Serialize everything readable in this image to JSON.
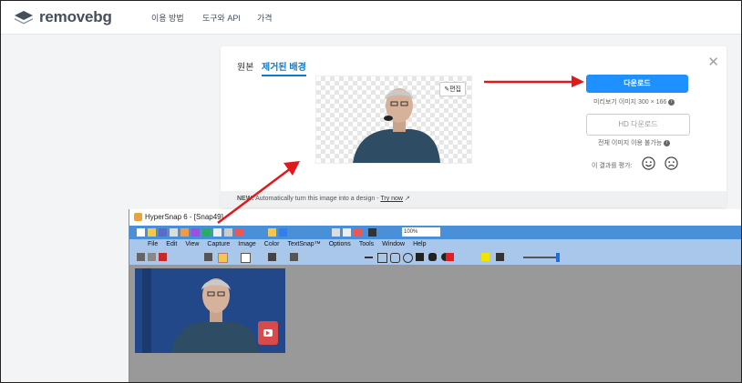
{
  "header": {
    "logo_text": "removebg",
    "nav": [
      "이용 방법",
      "도구와 API",
      "가격"
    ]
  },
  "editor": {
    "tabs": [
      "원본",
      "제거된 배경"
    ],
    "active_tab": "제거된 배경",
    "edit_label": "편집",
    "download_label": "다운로드",
    "preview_note": "미리보기 이미지 300 × 166",
    "hd_download_label": "HD 다운로드",
    "hd_note": "전체 이미지 이용 불가능",
    "rate_label": "이 결과를 평가:",
    "banner_new": "NEW:",
    "banner_text": "Automatically turn this image into a design -",
    "banner_link": "Try now"
  },
  "hypersnap": {
    "title": "HyperSnap 6 - [Snap49]",
    "zoom": "100%",
    "menu": [
      "File",
      "Edit",
      "View",
      "Capture",
      "Image",
      "Color",
      "TextSnap™",
      "Options",
      "Tools",
      "Window",
      "Help"
    ]
  },
  "colors": {
    "accent": "#1e90ff",
    "arrow": "#e0191b",
    "tab_active": "#0a7aca"
  }
}
